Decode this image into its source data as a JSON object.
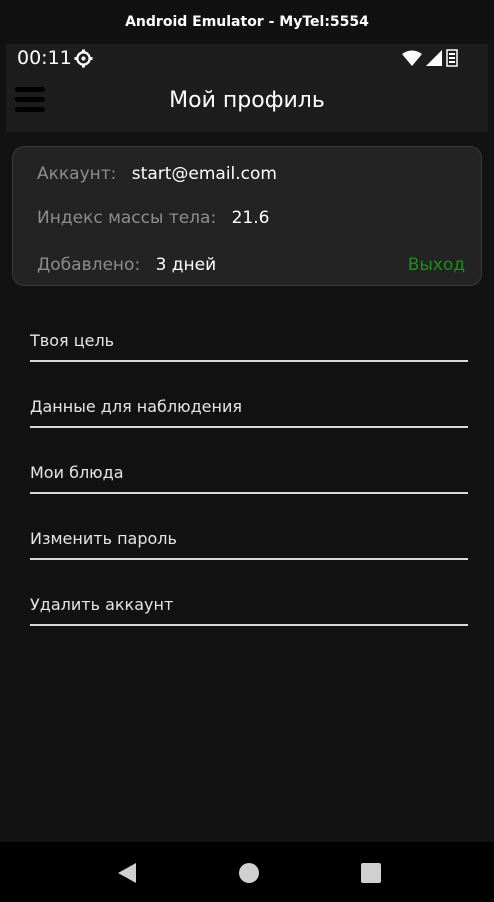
{
  "window": {
    "title": "Android Emulator - MyTel:5554"
  },
  "status_bar": {
    "time": "00:11",
    "icons": [
      "gear-icon",
      "wifi-icon",
      "cell-signal-icon",
      "sim-card-icon"
    ]
  },
  "app_bar": {
    "title": "Мой профиль",
    "menu_icon": "hamburger-menu-icon"
  },
  "profile_card": {
    "account_label": "Аккаунт:",
    "account_value": "start@email.com",
    "bmi_label": "Индекс массы тела:",
    "bmi_value": "21.6",
    "added_label": "Добавлено:",
    "added_value": "3 дней",
    "logout_label": "Выход"
  },
  "menu": {
    "items": [
      {
        "label": "Твоя цель"
      },
      {
        "label": "Данные для наблюдения"
      },
      {
        "label": "Мои блюда"
      },
      {
        "label": "Изменить пароль"
      },
      {
        "label": "Удалить аккаунт"
      }
    ]
  },
  "nav_bar": {
    "icons": [
      "back-triangle-icon",
      "home-circle-icon",
      "recents-square-icon"
    ]
  },
  "colors": {
    "background": "#121212",
    "card": "#232323",
    "accent_logout": "#1e8c1e",
    "label_gray": "#8d8d8d"
  }
}
